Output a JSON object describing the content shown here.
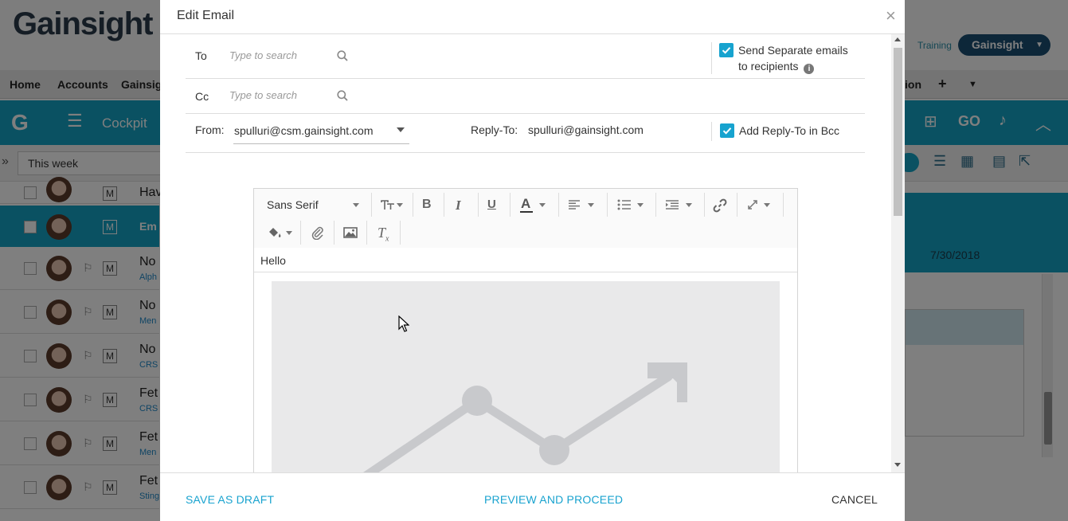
{
  "background": {
    "logo_text": "Gainsight",
    "training_link": "Training",
    "brand_button": "Gainsight",
    "nav": [
      "Home",
      "Accounts",
      "Gainsig",
      "ion"
    ],
    "module": "Cockpit",
    "filter_value": "This week",
    "rows": [
      {
        "title": "Hav",
        "sub": ""
      },
      {
        "title": "Em",
        "sub": ""
      },
      {
        "title": "No",
        "sub": "Alph"
      },
      {
        "title": "No",
        "sub": "Men"
      },
      {
        "title": "No",
        "sub": "CRS"
      },
      {
        "title": "Fet",
        "sub": "CRS"
      },
      {
        "title": "Fet",
        "sub": "Men"
      },
      {
        "title": "Fet",
        "sub": "Sting"
      }
    ],
    "row_badge": "M",
    "right_date": "7/30/2018",
    "go_label": "GO"
  },
  "modal": {
    "title": "Edit Email",
    "to_label": "To",
    "to_placeholder": "Type to search",
    "cc_label": "Cc",
    "cc_placeholder": "Type to search",
    "send_separate_line1": "Send Separate emails",
    "send_separate_line2": "to recipients",
    "send_separate_checked": true,
    "from_label": "From:",
    "from_value": "spulluri@csm.gainsight.com",
    "reply_to_label": "Reply-To:",
    "reply_to_value": "spulluri@gainsight.com",
    "add_reply_bcc_label": "Add Reply-To in Bcc",
    "add_reply_bcc_checked": true,
    "editor": {
      "font_family": "Sans Serif",
      "subject_text": "Hello",
      "tools": [
        "font-size",
        "bold",
        "italic",
        "underline",
        "text-color",
        "align",
        "list",
        "indent",
        "link",
        "fullscreen",
        "fill-color",
        "attachment",
        "image",
        "clear-format"
      ]
    },
    "footer": {
      "save_draft": "SAVE AS DRAFT",
      "preview_proceed": "PREVIEW AND PROCEED",
      "cancel": "CANCEL"
    },
    "accent_color": "#19a3cf"
  }
}
